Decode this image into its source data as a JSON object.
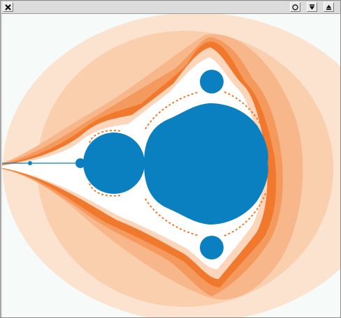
{
  "window": {
    "title": "",
    "buttons": {
      "close_icon": "close-icon",
      "minimize_icon": "circle-icon",
      "shade_icon": "arrow-down-icon",
      "maximize_icon": "eject-icon"
    }
  },
  "fractal": {
    "name": "Mandelbrot set",
    "colors": {
      "background": "#f6faf9",
      "set": "#0a80c0",
      "band_outer": "#fbe3cf",
      "band_2": "#f9cfae",
      "band_3": "#f8b78a",
      "band_4": "#f49a5e",
      "band_5": "#f1792e",
      "band_6": "#fcd6bb",
      "band_7": "#ffffff"
    }
  }
}
